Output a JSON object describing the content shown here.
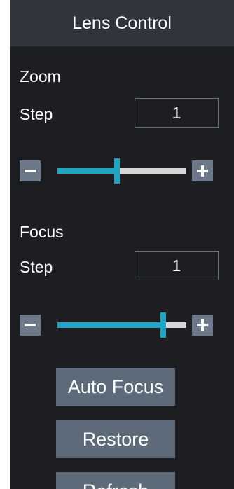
{
  "header": {
    "title": "Lens Control"
  },
  "zoom": {
    "label": "Zoom",
    "step_label": "Step",
    "step_value": "1",
    "slider_level": 0.46
  },
  "focus": {
    "label": "Focus",
    "step_label": "Step",
    "step_value": "1",
    "slider_level": 0.82
  },
  "buttons": {
    "auto_focus": "Auto Focus",
    "restore": "Restore",
    "refresh": "Refresh"
  },
  "icons": {
    "decrease": "minus-icon",
    "increase": "plus-icon"
  },
  "colors": {
    "panel_bg": "#1c1e22",
    "header_bg": "#30353d",
    "accent": "#1fa4c4",
    "button_bg": "#5d6a79"
  }
}
